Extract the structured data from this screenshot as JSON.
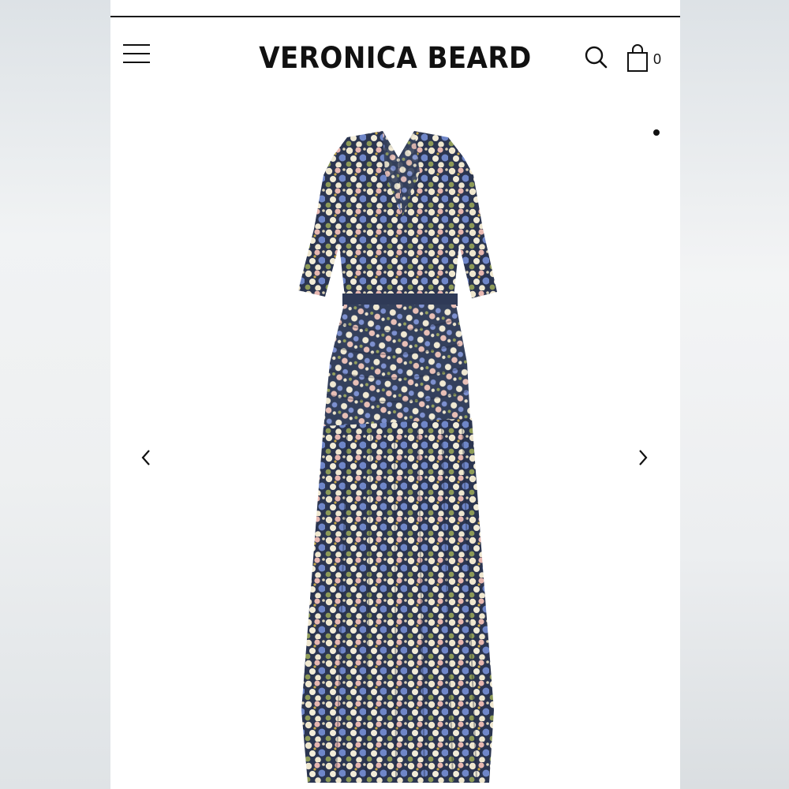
{
  "header": {
    "brand": "VERONICA BEARD",
    "cart_count": "0"
  },
  "icons": {
    "menu": "hamburger-menu-icon",
    "search": "search-icon",
    "cart": "shopping-bag-icon",
    "prev": "chevron-left-icon",
    "next": "chevron-right-icon"
  },
  "carousel": {
    "current_slide": 1
  },
  "colors": {
    "text": "#111111",
    "background": "#ffffff",
    "print_navy": "#2b3550",
    "print_blue": "#6f86c8",
    "print_pink": "#e7b7b0",
    "print_cream": "#efe7cf",
    "print_olive": "#8d9a58"
  }
}
